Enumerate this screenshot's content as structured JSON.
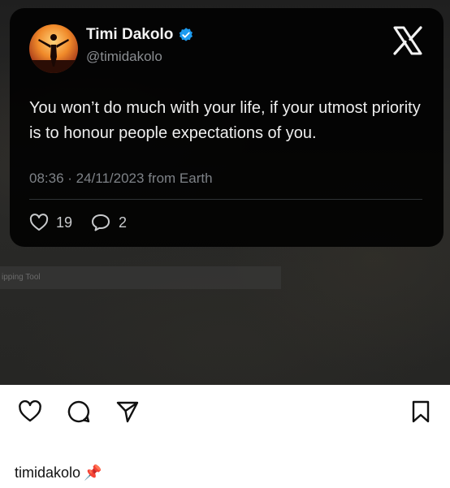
{
  "tweet": {
    "author_name": "Timi Dakolo",
    "handle": "@timidakolo",
    "text": "You won’t do much with your life,  if your utmost priority is to honour people expectations of you.",
    "meta": "08:36 · 24/11/2023 from Earth",
    "likes": "19",
    "replies": "2"
  },
  "overlay": {
    "snip_label": "ipping Tool"
  },
  "post": {
    "username": "timidakolo",
    "emoji": "📌"
  },
  "icons": {
    "verified": "verified-badge-icon",
    "x_logo": "x-logo-icon",
    "like": "heart-icon",
    "reply": "speech-bubble-icon",
    "ig_like": "heart-icon",
    "ig_comment": "comment-icon",
    "ig_share": "send-icon",
    "ig_save": "bookmark-icon"
  },
  "colors": {
    "verified_blue": "#1d9bf0",
    "card_bg": "#020202"
  }
}
